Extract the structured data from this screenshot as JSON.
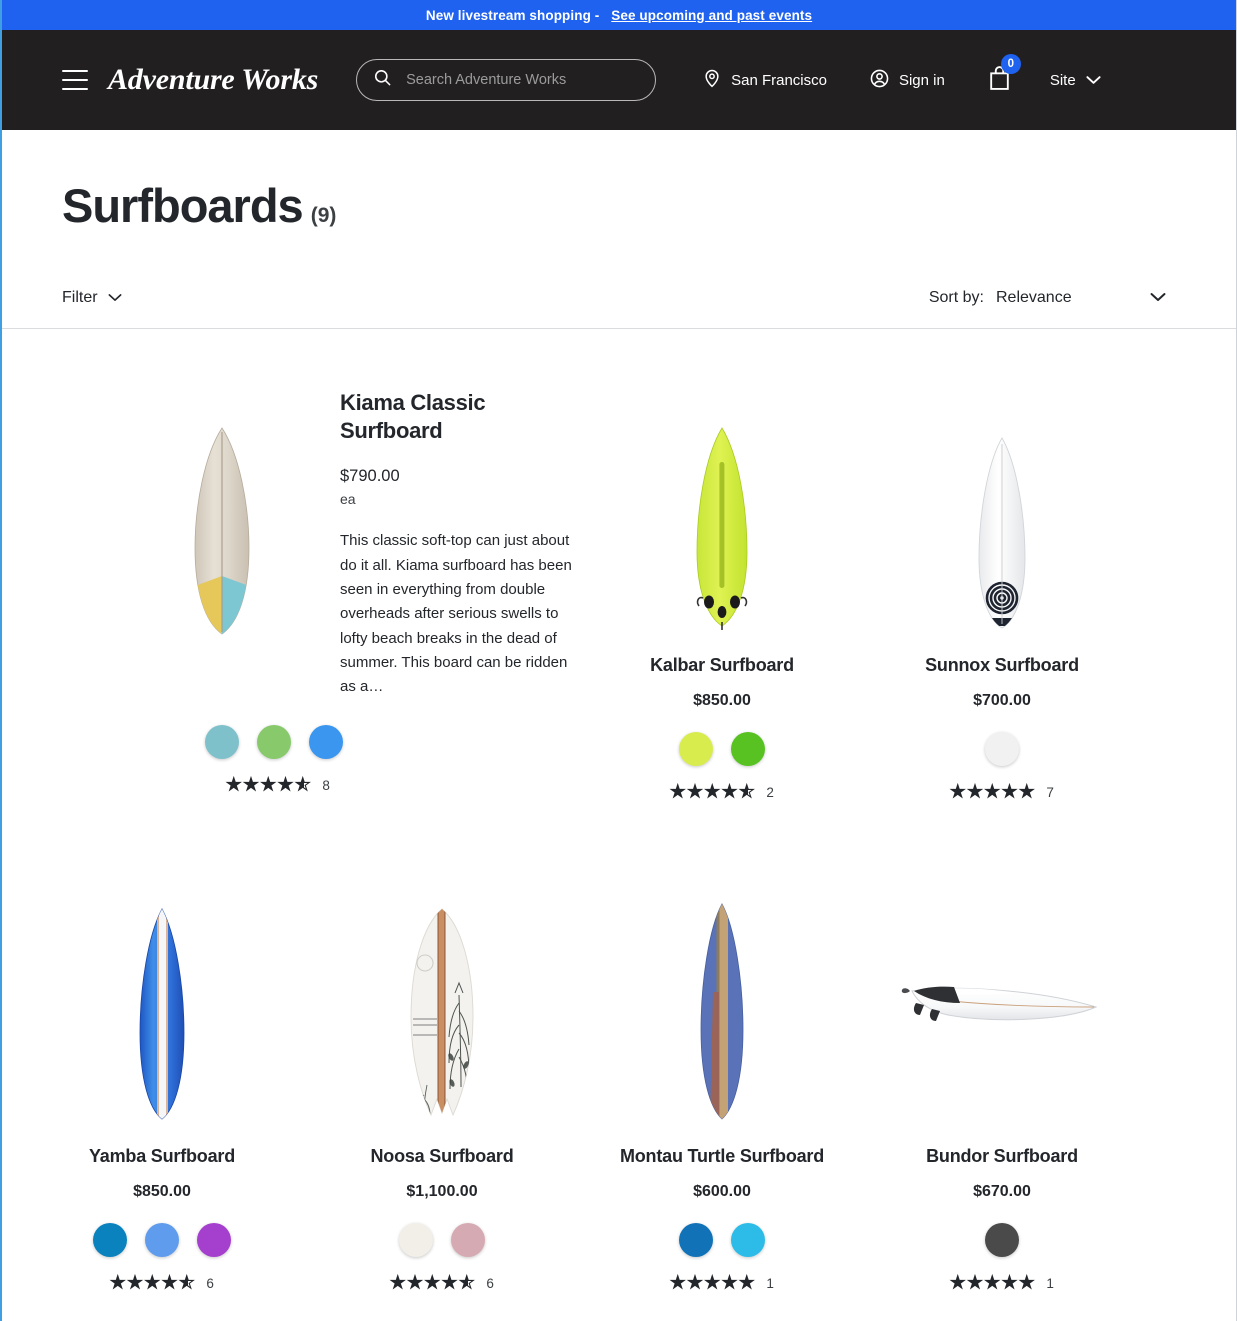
{
  "promo": {
    "message": "New livestream shopping -",
    "link_text": "See upcoming and past events"
  },
  "header": {
    "brand": "Adventure Works",
    "search_placeholder": "Search Adventure Works",
    "search_value": "",
    "location": "San Francisco",
    "signin": "Sign in",
    "cart_count": "0",
    "site": "Site"
  },
  "listing": {
    "title": "Surfboards",
    "count": "(9)",
    "filter_label": "Filter",
    "sort_label": "Sort by:",
    "sort_value": "Relevance"
  },
  "products": [
    {
      "name": "Kiama Classic Surfboard",
      "price": "$790.00",
      "uom": "ea",
      "description": "This classic soft-top can just about do it all. Kiama surfboard has been seen in everything from double overheads after serious swells to lofty beach breaks in the dead of summer. This board can be ridden as a…",
      "swatches": [
        "#7fc1cb",
        "#88c96b",
        "#3a96ef"
      ],
      "rating": 4.5,
      "rating_count": "8"
    },
    {
      "name": "Kalbar Surfboard",
      "price": "$850.00",
      "swatches": [
        "#d9ec4e",
        "#57c222"
      ],
      "rating": 4.5,
      "rating_count": "2"
    },
    {
      "name": "Sunnox Surfboard",
      "price": "$700.00",
      "swatches": [
        "#f1f1f1"
      ],
      "rating": 5,
      "rating_count": "7"
    },
    {
      "name": "Yamba Surfboard",
      "price": "$850.00",
      "swatches": [
        "#0a82bd",
        "#5f9cee",
        "#a53fce"
      ],
      "rating": 4.5,
      "rating_count": "6"
    },
    {
      "name": "Noosa Surfboard",
      "price": "$1,100.00",
      "swatches": [
        "#f2efe9",
        "#d6aab3"
      ],
      "rating": 4.5,
      "rating_count": "6"
    },
    {
      "name": "Montau Turtle Surfboard",
      "price": "$600.00",
      "swatches": [
        "#1272b8",
        "#2dbbe8"
      ],
      "rating": 5,
      "rating_count": "1"
    },
    {
      "name": "Bundor Surfboard",
      "price": "$670.00",
      "swatches": [
        "#4a4a4a"
      ],
      "rating": 5,
      "rating_count": "1"
    }
  ],
  "colors": {
    "promo_bg": "#1f62f0",
    "header_bg": "#221f20",
    "accent": "#1f62f0",
    "text": "#23262b"
  }
}
